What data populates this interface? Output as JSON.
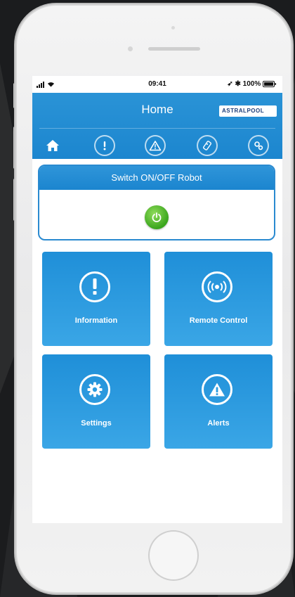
{
  "status_bar": {
    "time": "09:41",
    "battery": "100%"
  },
  "app_bar": {
    "title": "Home",
    "logo_text": "ASTRALPOOL"
  },
  "tabs": [
    {
      "icon": "home-icon",
      "active": true
    },
    {
      "icon": "information-icon",
      "active": false
    },
    {
      "icon": "alert-icon",
      "active": false
    },
    {
      "icon": "remote-icon",
      "active": false
    },
    {
      "icon": "settings-icon",
      "active": false
    }
  ],
  "switch_card": {
    "title": "Switch ON/OFF Robot",
    "power_state_color": "#3aa51d"
  },
  "tiles": [
    {
      "label": "Information",
      "icon": "information-icon"
    },
    {
      "label": "Remote Control",
      "icon": "remote-control-icon"
    },
    {
      "label": "Settings",
      "icon": "gear-icon"
    },
    {
      "label": "Alerts",
      "icon": "warning-icon"
    }
  ],
  "colors": {
    "accent": "#1c86cf",
    "tile": "#2a9be0",
    "power": "#3aa51d"
  }
}
